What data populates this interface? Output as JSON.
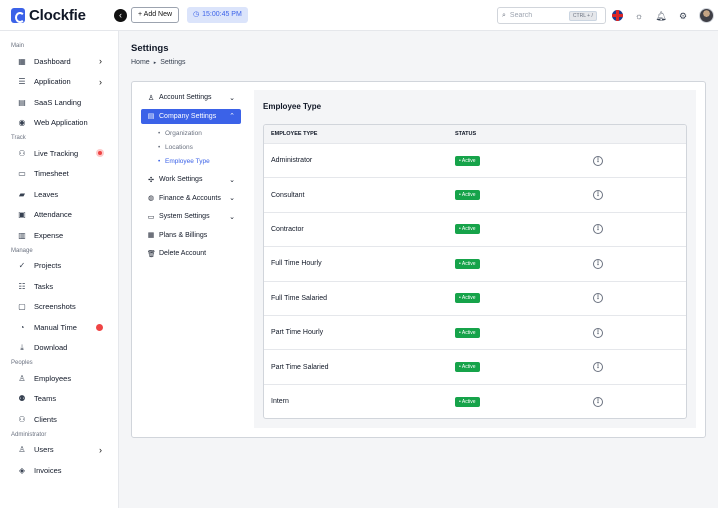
{
  "app": {
    "name": "Clockfie"
  },
  "topbar": {
    "add_new_label": "+ Add New",
    "timer": "15:00:45 PM",
    "search_placeholder": "Search",
    "search_shortcut": "CTRL + /"
  },
  "sidebar": {
    "sections": [
      {
        "title": "Main",
        "items": [
          {
            "label": "Dashboard",
            "icon": "grid-icon",
            "chevron": true
          },
          {
            "label": "Application",
            "icon": "server-icon",
            "chevron": true
          },
          {
            "label": "SaaS Landing",
            "icon": "stack-icon"
          },
          {
            "label": "Web Application",
            "icon": "globe-icon"
          }
        ]
      },
      {
        "title": "Track",
        "items": [
          {
            "label": "Live Tracking",
            "icon": "user-activity-icon",
            "recording": true
          },
          {
            "label": "Timesheet",
            "icon": "timesheet-icon"
          },
          {
            "label": "Leaves",
            "icon": "leaves-icon"
          },
          {
            "label": "Attendance",
            "icon": "calendar-icon"
          },
          {
            "label": "Expense",
            "icon": "receipt-icon"
          }
        ]
      },
      {
        "title": "Manage",
        "items": [
          {
            "label": "Projects",
            "icon": "check-circle-icon"
          },
          {
            "label": "Tasks",
            "icon": "tasks-icon"
          },
          {
            "label": "Screenshots",
            "icon": "screenshot-icon"
          },
          {
            "label": "Manual Time",
            "icon": "clock-icon",
            "badge": true
          },
          {
            "label": "Download",
            "icon": "download-icon"
          }
        ]
      },
      {
        "title": "Peoples",
        "items": [
          {
            "label": "Employees",
            "icon": "user-icon"
          },
          {
            "label": "Teams",
            "icon": "team-icon"
          },
          {
            "label": "Clients",
            "icon": "clients-icon"
          }
        ]
      },
      {
        "title": "Administrator",
        "items": [
          {
            "label": "Users",
            "icon": "users-icon",
            "chevron": true
          },
          {
            "label": "Invoices",
            "icon": "invoice-icon"
          }
        ]
      }
    ]
  },
  "page": {
    "title": "Settings",
    "breadcrumb": {
      "home": "Home",
      "current": "Settings"
    }
  },
  "settings_menu": {
    "account": "Account Settings",
    "company": "Company Settings",
    "sub": [
      "Organization",
      "Locations",
      "Employee Type"
    ],
    "work": "Work Settings",
    "finance": "Finance & Accounts",
    "system": "System Settings",
    "plans": "Plans & Billings",
    "delete": "Delete Account"
  },
  "employee_type": {
    "title": "Employee Type",
    "columns": {
      "type": "EMPLOYEE TYPE",
      "status": "STATUS"
    },
    "rows": [
      {
        "type": "Administrator",
        "status": "Active"
      },
      {
        "type": "Consultant",
        "status": "Active"
      },
      {
        "type": "Contractor",
        "status": "Active"
      },
      {
        "type": "Full Time Hourly",
        "status": "Active"
      },
      {
        "type": "Full Time Salaried",
        "status": "Active"
      },
      {
        "type": "Part Time Hourly",
        "status": "Active"
      },
      {
        "type": "Part Time Salaried",
        "status": "Active"
      },
      {
        "type": "Intern",
        "status": "Active"
      }
    ]
  },
  "colors": {
    "accent": "#3b62e8",
    "active_badge": "#16a34a"
  }
}
